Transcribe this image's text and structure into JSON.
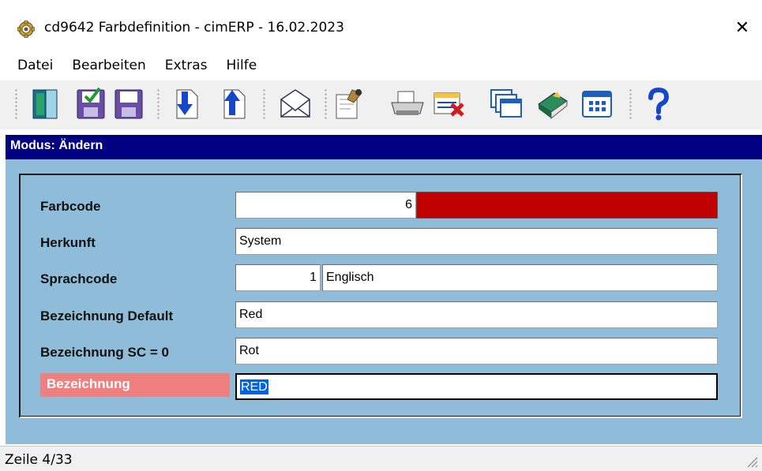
{
  "window": {
    "title": "cd9642 Farbdefinition - cimERP - 16.02.2023",
    "close_glyph": "✕"
  },
  "menu": [
    "Datei",
    "Bearbeiten",
    "Extras",
    "Hilfe"
  ],
  "toolbar": {
    "icons": [
      "exit-door-icon",
      "save-check-icon",
      "save-icon",
      "arrow-down-icon",
      "arrow-up-icon",
      "mail-icon",
      "edit-document-icon",
      "printer-icon",
      "delete-record-icon",
      "windows-icon",
      "book-icon",
      "calendar-icon",
      "help-icon"
    ]
  },
  "mode": "Modus: Ändern",
  "form": {
    "farbcode": {
      "label": "Farbcode",
      "value": "6",
      "swatch_color": "#c00000"
    },
    "herkunft": {
      "label": "Herkunft",
      "value": "System"
    },
    "sprachcode": {
      "label": "Sprachcode",
      "code": "1",
      "name": "Englisch"
    },
    "bez_default": {
      "label": "Bezeichnung Default",
      "value": "Red"
    },
    "bez_sc0": {
      "label": "Bezeichnung SC = 0",
      "value": "Rot"
    },
    "bezeichnung": {
      "label": "Bezeichnung",
      "value": "RED"
    }
  },
  "status": "Zeile 4/33",
  "colors": {
    "mode_bar": "#000080",
    "panel_bg": "#8fbdd9",
    "active_label": "#f08080",
    "selection": "#0063e1"
  }
}
